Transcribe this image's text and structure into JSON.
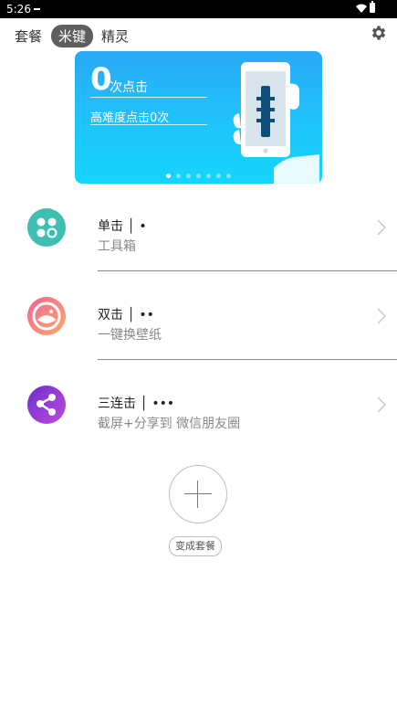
{
  "status_bar": {
    "time": "5:26"
  },
  "tabs": [
    {
      "label": "套餐"
    },
    {
      "label": "米键"
    },
    {
      "label": "精灵"
    }
  ],
  "banner": {
    "count": "0",
    "count_label": "次点击",
    "difficulty_text": "高难度点击0次",
    "pages_count": 7,
    "active_page": 1
  },
  "actions": [
    {
      "title": "单击",
      "dots": "•",
      "subtitle": "工具箱",
      "icon": "apps-grid-icon",
      "color": "#3fbfb2"
    },
    {
      "title": "双击",
      "dots": "••",
      "subtitle": "一键换壁纸",
      "icon": "wallpaper-icon",
      "color": "#f57b8a"
    },
    {
      "title": "三连击",
      "dots": "•••",
      "subtitle": "截屏+分享到 微信朋友圈",
      "icon": "share-icon",
      "color": "#8e3fd1"
    }
  ],
  "add_button": {
    "icon": "plus-icon"
  },
  "change_button": {
    "label": "变成套餐"
  }
}
